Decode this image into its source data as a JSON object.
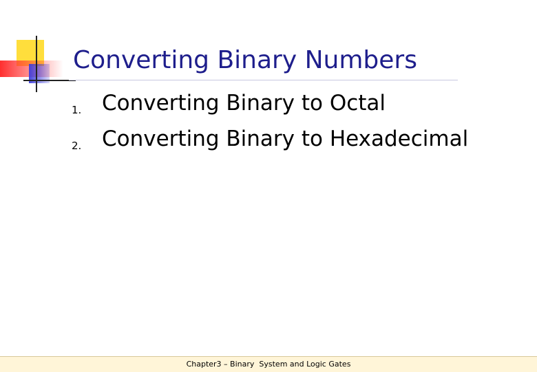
{
  "slide": {
    "title": "Converting Binary Numbers",
    "items": [
      {
        "number": "1.",
        "text": "Converting Binary to Octal"
      },
      {
        "number": "2.",
        "text": "Converting Binary to Hexadecimal"
      }
    ]
  },
  "footer": {
    "text": "Chapter3 – Binary  System and Logic Gates"
  },
  "colors": {
    "title": "#1e1e8c",
    "logo_yellow": "#ffde3c",
    "logo_red": "#ff3c3c",
    "logo_blue": "#3c3cdc",
    "footer_background": "#fff5d8"
  }
}
